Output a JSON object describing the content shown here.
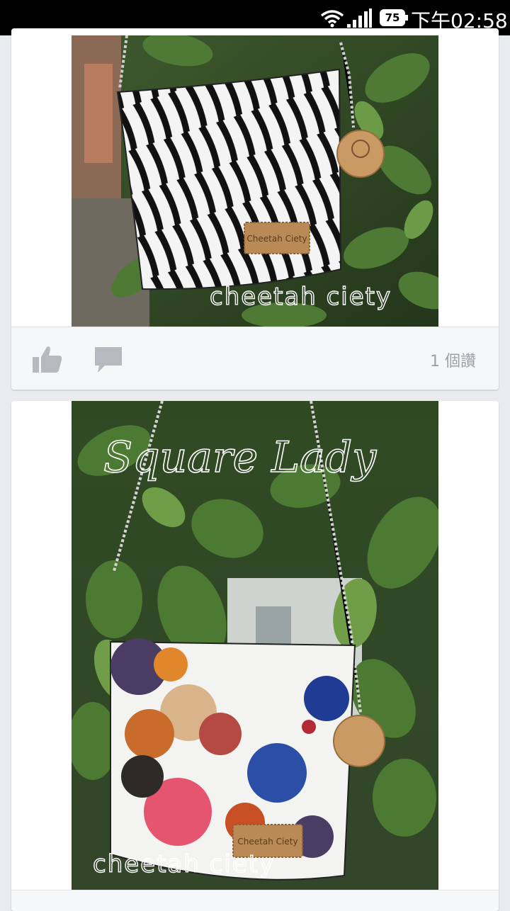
{
  "status_bar": {
    "time": "下午02:58",
    "battery": "75",
    "icons": [
      "wifi-icon",
      "signal-icon",
      "battery-icon"
    ]
  },
  "posts": [
    {
      "photo_watermark": "cheetah ciety",
      "photo_label_tag": "Cheetah Ciety",
      "likes_text": "1 個讚",
      "actions": [
        "like-icon",
        "comment-icon"
      ]
    },
    {
      "photo_title": "Square Lady",
      "photo_watermark": "cheetah ciety",
      "photo_label_tag": "Cheetah Ciety"
    }
  ],
  "colors": {
    "feed_background": "#e9ebee",
    "action_bar": "#f6f7f9",
    "icon_gray": "#b6b9be",
    "likes_text": "#9da0a5"
  }
}
